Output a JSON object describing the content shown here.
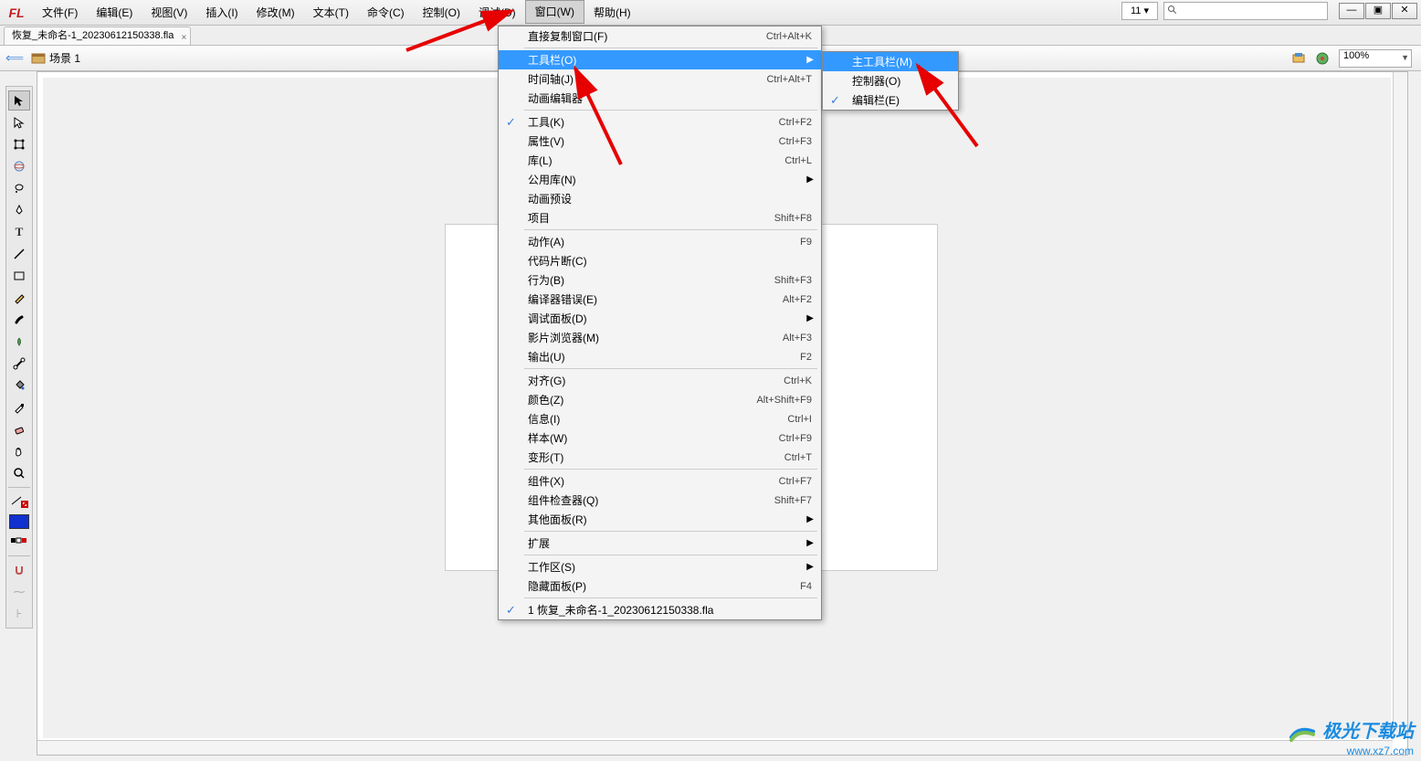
{
  "app": {
    "logo": "FL"
  },
  "menu": {
    "items": [
      "文件(F)",
      "编辑(E)",
      "视图(V)",
      "插入(I)",
      "修改(M)",
      "文本(T)",
      "命令(C)",
      "控制(O)",
      "调试(D)",
      "窗口(W)",
      "帮助(H)"
    ],
    "activeIndex": 9
  },
  "topRight": {
    "number": "11",
    "searchPlaceholder": ""
  },
  "file_tab": {
    "name": "恢复_未命名-1_20230612150338.fla"
  },
  "scene": {
    "name": "场景 1",
    "zoom": "100%"
  },
  "dropdown_main": [
    {
      "label": "直接复制窗口(F)",
      "shortcut": "Ctrl+Alt+K"
    },
    {
      "sep": true
    },
    {
      "label": "工具栏(O)",
      "submenu": true,
      "hl": true
    },
    {
      "label": "时间轴(J)",
      "shortcut": "Ctrl+Alt+T"
    },
    {
      "label": "动画编辑器"
    },
    {
      "sep": true
    },
    {
      "label": "工具(K)",
      "shortcut": "Ctrl+F2",
      "checked": true
    },
    {
      "label": "属性(V)",
      "shortcut": "Ctrl+F3"
    },
    {
      "label": "库(L)",
      "shortcut": "Ctrl+L"
    },
    {
      "label": "公用库(N)",
      "submenu": true
    },
    {
      "label": "动画预设"
    },
    {
      "label": "项目",
      "shortcut": "Shift+F8"
    },
    {
      "sep": true
    },
    {
      "label": "动作(A)",
      "shortcut": "F9"
    },
    {
      "label": "代码片断(C)"
    },
    {
      "label": "行为(B)",
      "shortcut": "Shift+F3"
    },
    {
      "label": "编译器错误(E)",
      "shortcut": "Alt+F2"
    },
    {
      "label": "调试面板(D)",
      "submenu": true
    },
    {
      "label": "影片浏览器(M)",
      "shortcut": "Alt+F3"
    },
    {
      "label": "输出(U)",
      "shortcut": "F2"
    },
    {
      "sep": true
    },
    {
      "label": "对齐(G)",
      "shortcut": "Ctrl+K"
    },
    {
      "label": "颜色(Z)",
      "shortcut": "Alt+Shift+F9"
    },
    {
      "label": "信息(I)",
      "shortcut": "Ctrl+I"
    },
    {
      "label": "样本(W)",
      "shortcut": "Ctrl+F9"
    },
    {
      "label": "变形(T)",
      "shortcut": "Ctrl+T"
    },
    {
      "sep": true
    },
    {
      "label": "组件(X)",
      "shortcut": "Ctrl+F7"
    },
    {
      "label": "组件检查器(Q)",
      "shortcut": "Shift+F7"
    },
    {
      "label": "其他面板(R)",
      "submenu": true
    },
    {
      "sep": true
    },
    {
      "label": "扩展",
      "submenu": true
    },
    {
      "sep": true
    },
    {
      "label": "工作区(S)",
      "submenu": true
    },
    {
      "label": "隐藏面板(P)",
      "shortcut": "F4"
    },
    {
      "sep": true
    },
    {
      "label": "1 恢复_未命名-1_20230612150338.fla",
      "checked": true
    }
  ],
  "dropdown_sub": [
    {
      "label": "主工具栏(M)",
      "hl": true
    },
    {
      "label": "控制器(O)"
    },
    {
      "label": "编辑栏(E)",
      "checked": true
    }
  ],
  "watermark": {
    "line1": "极光下载站",
    "line2": "www.xz7.com"
  }
}
